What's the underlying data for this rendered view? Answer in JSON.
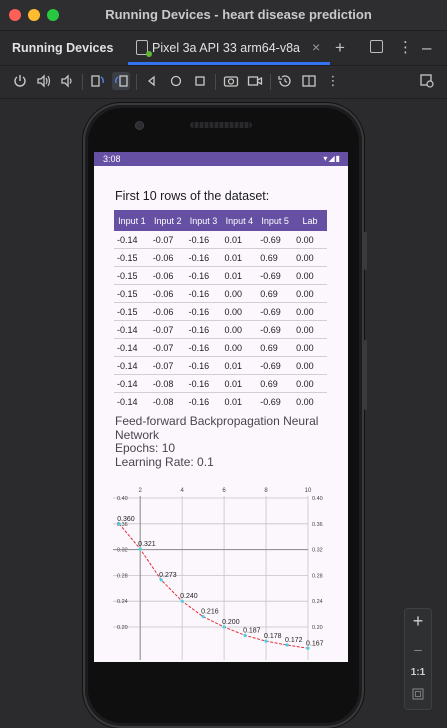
{
  "window": {
    "title": "Running Devices - heart disease prediction"
  },
  "panel": {
    "title": "Running Devices"
  },
  "tab": {
    "label": "Pixel 3a API 33 arm64-v8a"
  },
  "header_buttons": [
    "plus-icon",
    "panel-icon",
    "more-icon",
    "minimize-icon"
  ],
  "toolbar_icons": [
    "power-icon",
    "volume-up-icon",
    "volume-down-icon",
    "rotate-left-icon",
    "rotate-right-icon",
    "back-icon",
    "home-icon",
    "overview-icon",
    "screenshot-icon",
    "screen-record-icon",
    "snapshot-icon",
    "fold-icon",
    "more-icon",
    "device-frame-icon"
  ],
  "statusbar": {
    "time": "3:08",
    "icons": "▾◢▮"
  },
  "screen": {
    "heading": "First 10 rows of the dataset:",
    "columns": [
      "Input 1",
      "Input 2",
      "Input 3",
      "Input 4",
      "Input 5",
      "Lab"
    ],
    "rows": [
      [
        "-0.14",
        "-0.07",
        "-0.16",
        "0.01",
        "-0.69",
        "0.00"
      ],
      [
        "-0.15",
        "-0.06",
        "-0.16",
        "0.01",
        "0.69",
        "0.00"
      ],
      [
        "-0.15",
        "-0.06",
        "-0.16",
        "0.01",
        "-0.69",
        "0.00"
      ],
      [
        "-0.15",
        "-0.06",
        "-0.16",
        "0.00",
        "0.69",
        "0.00"
      ],
      [
        "-0.15",
        "-0.06",
        "-0.16",
        "0.00",
        "-0.69",
        "0.00"
      ],
      [
        "-0.14",
        "-0.07",
        "-0.16",
        "0.00",
        "-0.69",
        "0.00"
      ],
      [
        "-0.14",
        "-0.07",
        "-0.16",
        "0.00",
        "0.69",
        "0.00"
      ],
      [
        "-0.14",
        "-0.07",
        "-0.16",
        "0.01",
        "-0.69",
        "0.00"
      ],
      [
        "-0.14",
        "-0.08",
        "-0.16",
        "0.01",
        "0.69",
        "0.00"
      ],
      [
        "-0.14",
        "-0.08",
        "-0.16",
        "0.01",
        "-0.69",
        "0.00"
      ]
    ],
    "info_lines": [
      "Feed-forward Backpropagation Neural",
      "Network",
      "Epochs: 10",
      "Learning Rate: 0.1"
    ]
  },
  "chart_data": {
    "type": "line",
    "x": [
      1,
      2,
      3,
      4,
      5,
      6,
      7,
      8,
      9,
      10
    ],
    "series": [
      {
        "values": [
          0.36,
          0.321,
          0.273,
          0.24,
          0.216,
          0.2,
          0.187,
          0.178,
          0.172,
          0.167
        ],
        "color": "#e0303a"
      }
    ],
    "point_labels": [
      "0.360",
      "0.321",
      "0.273",
      "0.240",
      "0.216",
      "0.200",
      "0.187",
      "0.178",
      "0.172",
      "0.167"
    ],
    "x_ticks": [
      "2",
      "4",
      "6",
      "8",
      "10"
    ],
    "x_tick_values": [
      2,
      4,
      6,
      8,
      10
    ],
    "y_ticks": [
      "0.40",
      "0.36",
      "0.32",
      "0.28",
      "0.24",
      "0.20"
    ],
    "y_tick_values": [
      0.4,
      0.36,
      0.32,
      0.28,
      0.24,
      0.2
    ],
    "xlim": [
      0.8,
      10
    ],
    "ylim": [
      0.155,
      0.4
    ],
    "grid": true,
    "point_color": "#4dd0e1"
  },
  "zoom": {
    "plus": "+",
    "ratio": "1:1"
  }
}
